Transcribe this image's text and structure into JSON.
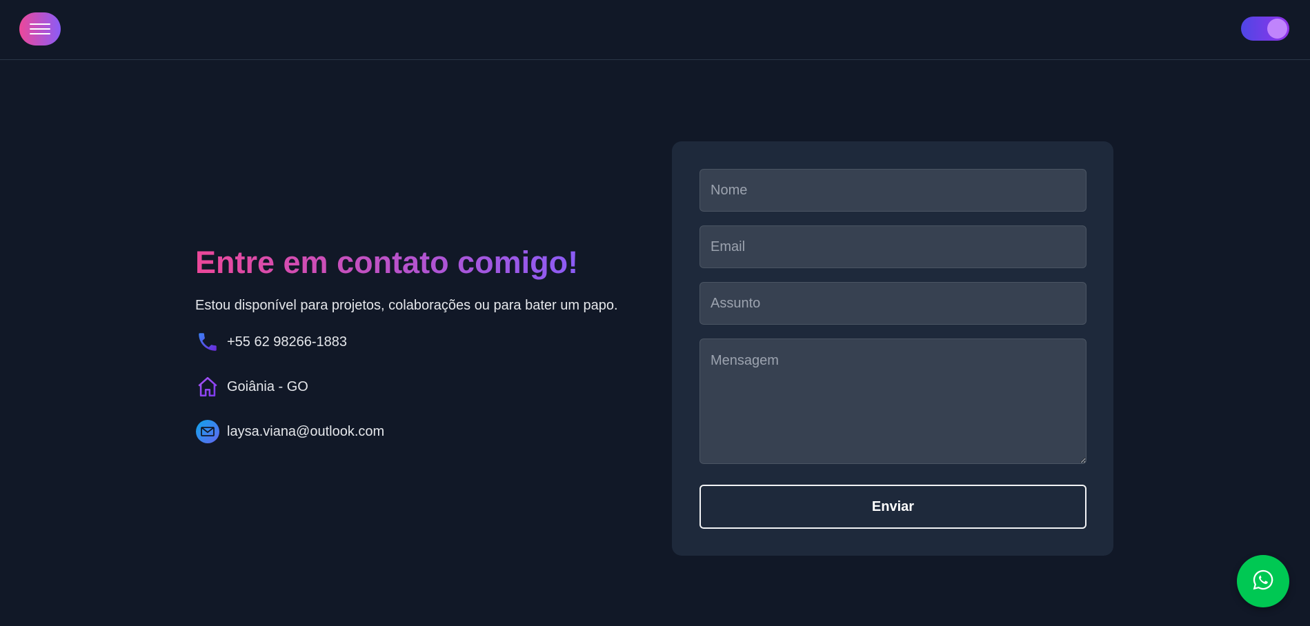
{
  "header": {
    "menu_icon": "hamburger-menu-icon",
    "theme_toggle_icon": "theme-toggle-icon"
  },
  "contact": {
    "title": "Entre em contato comigo!",
    "subtitle": "Estou disponível para projetos, colaborações ou para bater um papo.",
    "phone": "+55 62 98266-1883",
    "location": "Goiânia - GO",
    "email": "laysa.viana@outlook.com",
    "phone_icon": "phone-icon",
    "location_icon": "home-icon",
    "email_icon": "mail-icon"
  },
  "form": {
    "name_placeholder": "Nome",
    "email_placeholder": "Email",
    "subject_placeholder": "Assunto",
    "message_placeholder": "Mensagem",
    "submit_label": "Enviar"
  },
  "floating": {
    "whatsapp_icon": "whatsapp-icon"
  },
  "colors": {
    "background": "#111827",
    "card": "#1e293b",
    "gradient_start": "#ec4899",
    "gradient_end": "#8b5cf6",
    "whatsapp": "#00c853"
  }
}
